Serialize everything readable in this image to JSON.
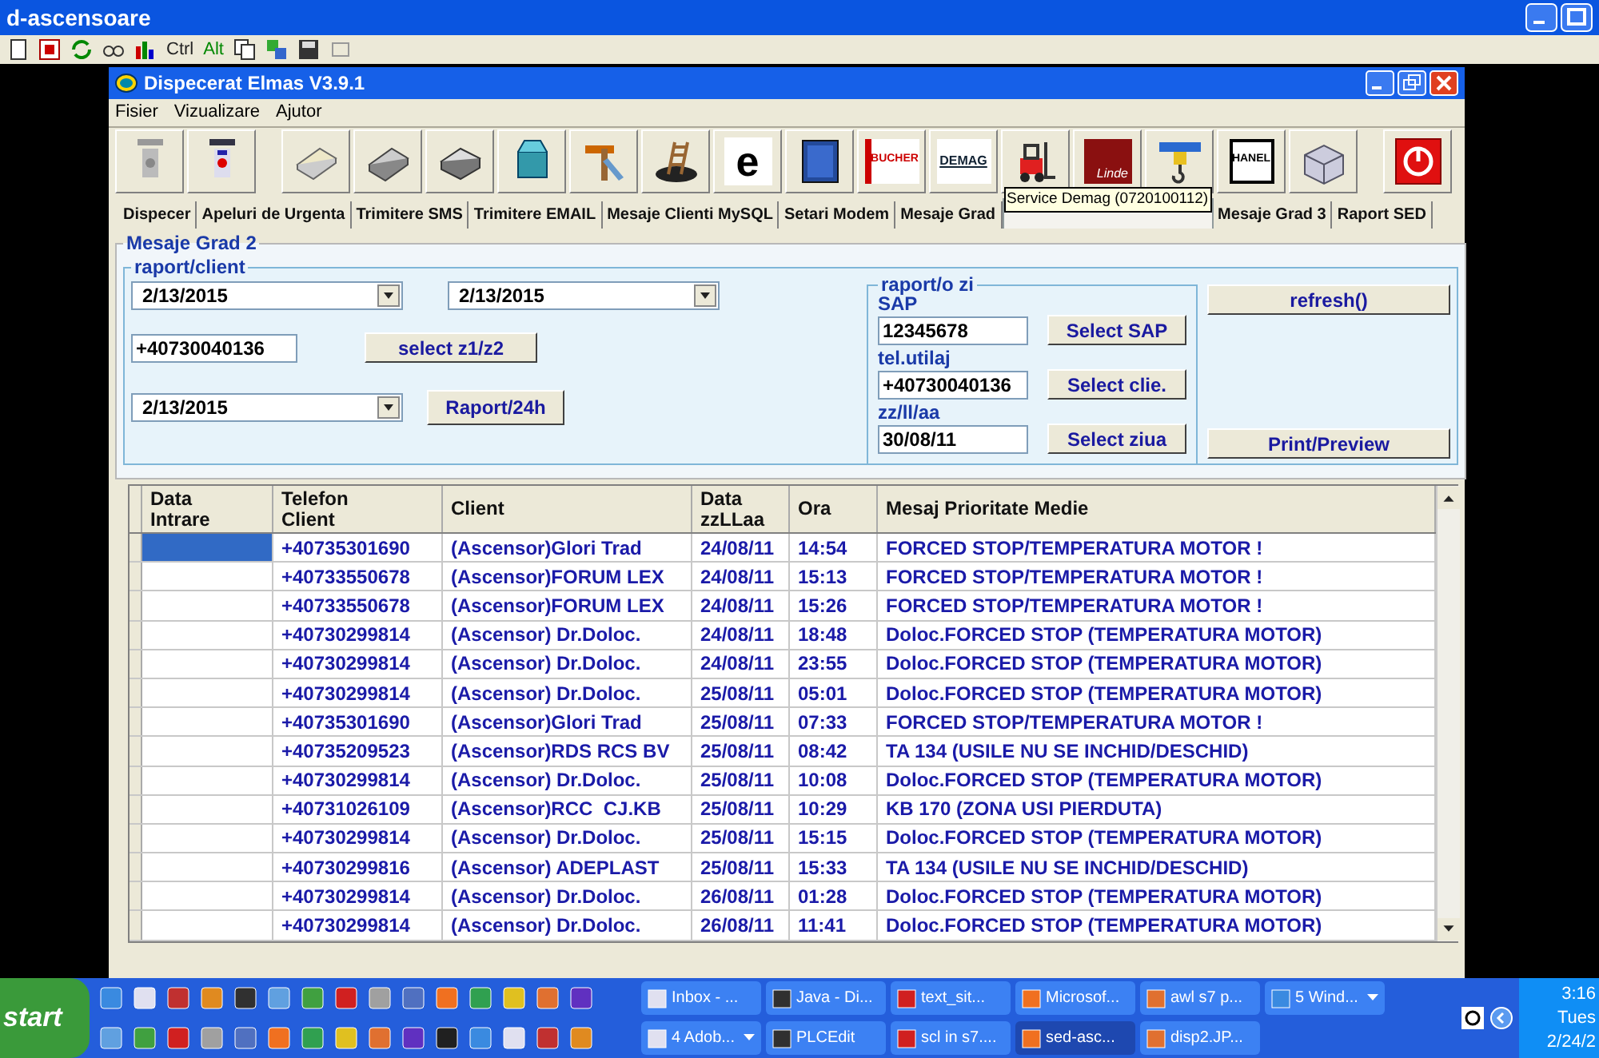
{
  "window": {
    "title": "d-ascensoare"
  },
  "host_toolbar": {
    "labels": [
      "Ctrl",
      "Alt"
    ]
  },
  "app": {
    "title": "Dispecerat Elmas V3.9.1",
    "menu": [
      "Fisier",
      "Vizualizare",
      "Ajutor"
    ],
    "toolbar": [
      {
        "kind": "icon"
      },
      {
        "kind": "icon"
      },
      {
        "kind": "icon"
      },
      {
        "kind": "icon"
      },
      {
        "kind": "icon"
      },
      {
        "kind": "icon"
      },
      {
        "kind": "icon"
      },
      {
        "kind": "icon"
      },
      {
        "kind": "logo",
        "label": "e"
      },
      {
        "kind": "icon"
      },
      {
        "kind": "logo",
        "label": "BUCHER"
      },
      {
        "kind": "logo",
        "label": "DEMAG"
      },
      {
        "kind": "icon"
      },
      {
        "kind": "logo",
        "label": "Linde"
      },
      {
        "kind": "icon"
      },
      {
        "kind": "logo",
        "label": "HANEL"
      },
      {
        "kind": "icon"
      },
      {
        "kind": "icon"
      }
    ],
    "tooltip": "Service Demag (0720100112)",
    "tabs": [
      {
        "label": "Dispecer",
        "selected": false
      },
      {
        "label": "Apeluri de Urgenta",
        "selected": false
      },
      {
        "label": "Trimitere SMS",
        "selected": false
      },
      {
        "label": "Trimitere EMAIL",
        "selected": false
      },
      {
        "label": "Mesaje Clienti MySQL",
        "selected": false
      },
      {
        "label": "Setari Modem",
        "selected": false
      },
      {
        "label": "Mesaje Grad",
        "selected": false
      },
      {
        "selected": true
      },
      {
        "label": "Mesaje Grad 3",
        "selected": false
      },
      {
        "label": "Raport SED",
        "selected": false
      }
    ],
    "panel": {
      "title": "Mesaje Grad 2",
      "client_group": {
        "title": "raport/client",
        "date_from": "2/13/2015",
        "date_to": "2/13/2015",
        "phone": "+40730040136",
        "select_button": "select z1/z2",
        "day": "2/13/2015",
        "day_button": "Raport/24h"
      },
      "day_group": {
        "title": "raport/o zi",
        "fields": [
          {
            "label": "SAP",
            "value": "12345678",
            "button": "Select SAP"
          },
          {
            "label": "tel.utilaj",
            "value": "+40730040136",
            "button": "Select clie."
          },
          {
            "label": "zz/ll/aa",
            "value": "30/08/11",
            "button": "Select ziua"
          }
        ]
      },
      "refresh_button": "refresh()",
      "print_button": "Print/Preview"
    },
    "table": {
      "columns": [
        "Data\nIntrare",
        "Telefon\nClient",
        "Client",
        "Data\nzzLLaa",
        "Ora",
        "Mesaj Prioritate Medie"
      ],
      "rows": [
        {
          "selected": true,
          "phone": "+40735301690",
          "client": "(Ascensor)Glori Trad",
          "date": "24/08/11",
          "time": "14:54",
          "message": "FORCED STOP/TEMPERATURA MOTOR !"
        },
        {
          "selected": false,
          "phone": "+40733550678",
          "client": "(Ascensor)FORUM LEX",
          "date": "24/08/11",
          "time": "15:13",
          "message": "FORCED STOP/TEMPERATURA MOTOR !"
        },
        {
          "selected": false,
          "phone": "+40733550678",
          "client": "(Ascensor)FORUM LEX",
          "date": "24/08/11",
          "time": "15:26",
          "message": "FORCED STOP/TEMPERATURA MOTOR !"
        },
        {
          "selected": false,
          "phone": "+40730299814",
          "client": "(Ascensor) Dr.Doloc.",
          "date": "24/08/11",
          "time": "18:48",
          "message": "Doloc.FORCED STOP (TEMPERATURA MOTOR)"
        },
        {
          "selected": false,
          "phone": "+40730299814",
          "client": "(Ascensor) Dr.Doloc.",
          "date": "24/08/11",
          "time": "23:55",
          "message": "Doloc.FORCED STOP (TEMPERATURA MOTOR)"
        },
        {
          "selected": false,
          "phone": "+40730299814",
          "client": "(Ascensor) Dr.Doloc.",
          "date": "25/08/11",
          "time": "05:01",
          "message": "Doloc.FORCED STOP (TEMPERATURA MOTOR)"
        },
        {
          "selected": false,
          "phone": "+40735301690",
          "client": "(Ascensor)Glori Trad",
          "date": "25/08/11",
          "time": "07:33",
          "message": "FORCED STOP/TEMPERATURA MOTOR !"
        },
        {
          "selected": false,
          "phone": "+40735209523",
          "client": "(Ascensor)RDS RCS BV",
          "date": "25/08/11",
          "time": "08:42",
          "message": "TA 134 (USILE NU SE INCHID/DESCHID)"
        },
        {
          "selected": false,
          "phone": "+40730299814",
          "client": "(Ascensor) Dr.Doloc.",
          "date": "25/08/11",
          "time": "10:08",
          "message": "Doloc.FORCED STOP (TEMPERATURA MOTOR)"
        },
        {
          "selected": false,
          "phone": "+40731026109",
          "client": "(Ascensor)RCC  CJ.KB",
          "date": "25/08/11",
          "time": "10:29",
          "message": "KB 170 (ZONA USI PIERDUTA)"
        },
        {
          "selected": false,
          "phone": "+40730299814",
          "client": "(Ascensor) Dr.Doloc.",
          "date": "25/08/11",
          "time": "15:15",
          "message": "Doloc.FORCED STOP (TEMPERATURA MOTOR)"
        },
        {
          "selected": false,
          "phone": "+40730299816",
          "client": "(Ascensor) ADEPLAST",
          "date": "25/08/11",
          "time": "15:33",
          "message": "TA 134 (USILE NU SE INCHID/DESCHID)"
        },
        {
          "selected": false,
          "phone": "+40730299814",
          "client": "(Ascensor) Dr.Doloc.",
          "date": "26/08/11",
          "time": "01:28",
          "message": "Doloc.FORCED STOP (TEMPERATURA MOTOR)"
        },
        {
          "selected": false,
          "phone": "+40730299814",
          "client": "(Ascensor) Dr.Doloc.",
          "date": "26/08/11",
          "time": "11:41",
          "message": "Doloc.FORCED STOP (TEMPERATURA MOTOR)"
        }
      ]
    }
  },
  "taskbar": {
    "start": "start",
    "tasks_top": [
      {
        "label": "Inbox - ...",
        "selected": false,
        "menu": false
      },
      {
        "label": "Java - Di...",
        "selected": false,
        "menu": false
      },
      {
        "label": "text_sit...",
        "selected": false,
        "menu": false
      },
      {
        "label": "Microsof...",
        "selected": false,
        "menu": false
      },
      {
        "label": "awl s7 p...",
        "selected": false,
        "menu": false
      },
      {
        "label": "5 Wind...",
        "selected": false,
        "menu": true
      }
    ],
    "tasks_bottom": [
      {
        "label": "4 Adob...",
        "selected": false,
        "menu": true
      },
      {
        "label": "PLCEdit",
        "selected": false,
        "menu": false
      },
      {
        "label": "scl in s7....",
        "selected": false,
        "menu": false
      },
      {
        "label": "sed-asc...",
        "selected": true,
        "menu": false
      },
      {
        "label": "disp2.JP...",
        "selected": false,
        "menu": false
      }
    ],
    "clock": "3:16",
    "day": "Tues",
    "date": "2/24/2"
  }
}
